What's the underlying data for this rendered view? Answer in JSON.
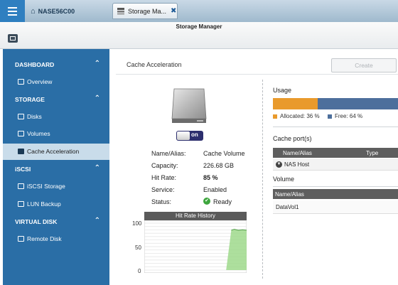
{
  "topbar": {
    "home_tab": "NASE56C00",
    "app_tab": "Storage Ma...",
    "close": "✖"
  },
  "app": {
    "title": "Storage Manager"
  },
  "sidebar": {
    "sections": [
      {
        "title": "DASHBOARD",
        "items": [
          {
            "label": "Overview",
            "icon": "overview-icon"
          }
        ]
      },
      {
        "title": "STORAGE",
        "items": [
          {
            "label": "Disks",
            "icon": "disks-icon"
          },
          {
            "label": "Volumes",
            "icon": "volumes-icon"
          },
          {
            "label": "Cache Acceleration",
            "icon": "cache-icon",
            "active": true
          }
        ]
      },
      {
        "title": "iSCSI",
        "items": [
          {
            "label": "iSCSI Storage",
            "icon": "iscsi-storage-icon"
          },
          {
            "label": "LUN Backup",
            "icon": "lun-backup-icon"
          }
        ]
      },
      {
        "title": "VIRTUAL DISK",
        "items": [
          {
            "label": "Remote Disk",
            "icon": "remote-disk-icon"
          }
        ]
      }
    ],
    "collapse_glyph": "⌃"
  },
  "main": {
    "title": "Cache Acceleration",
    "create_label": "Create",
    "toggle_label": "on",
    "properties": [
      {
        "label": "Name/Alias:",
        "value": "Cache Volume"
      },
      {
        "label": "Capacity:",
        "value": "226.68 GB"
      },
      {
        "label": "Hit Rate:",
        "value": "85 %"
      },
      {
        "label": "Service:",
        "value": "Enabled"
      },
      {
        "label": "Status:",
        "value": "Ready"
      }
    ]
  },
  "chart_data": {
    "type": "area",
    "title": "Hit Rate History",
    "yticks": [
      "100",
      "50",
      "0"
    ],
    "ylim": [
      0,
      100
    ],
    "x": [
      0,
      10,
      20,
      30,
      40,
      50,
      60,
      70,
      80,
      85,
      88,
      92,
      96,
      100
    ],
    "values": [
      0,
      0,
      0,
      0,
      0,
      0,
      0,
      0,
      0,
      85,
      87,
      85,
      86,
      85
    ],
    "grid": true,
    "color": "#9fd98c"
  },
  "usage": {
    "label": "Usage",
    "allocated_pct": 36,
    "allocated_label": "Allocated: 36 %",
    "free_label": "Free: 64 %",
    "colors": {
      "allocated": "#e99a2c",
      "free": "#4d6f9c"
    }
  },
  "cache_ports": {
    "title": "Cache port(s)",
    "columns": [
      "Name/Alias",
      "Type"
    ],
    "rows": [
      [
        "NAS Host",
        ""
      ]
    ]
  },
  "volume": {
    "title": "Volume",
    "columns": [
      "Name/Alias"
    ],
    "rows": [
      [
        "DataVol1"
      ]
    ]
  }
}
